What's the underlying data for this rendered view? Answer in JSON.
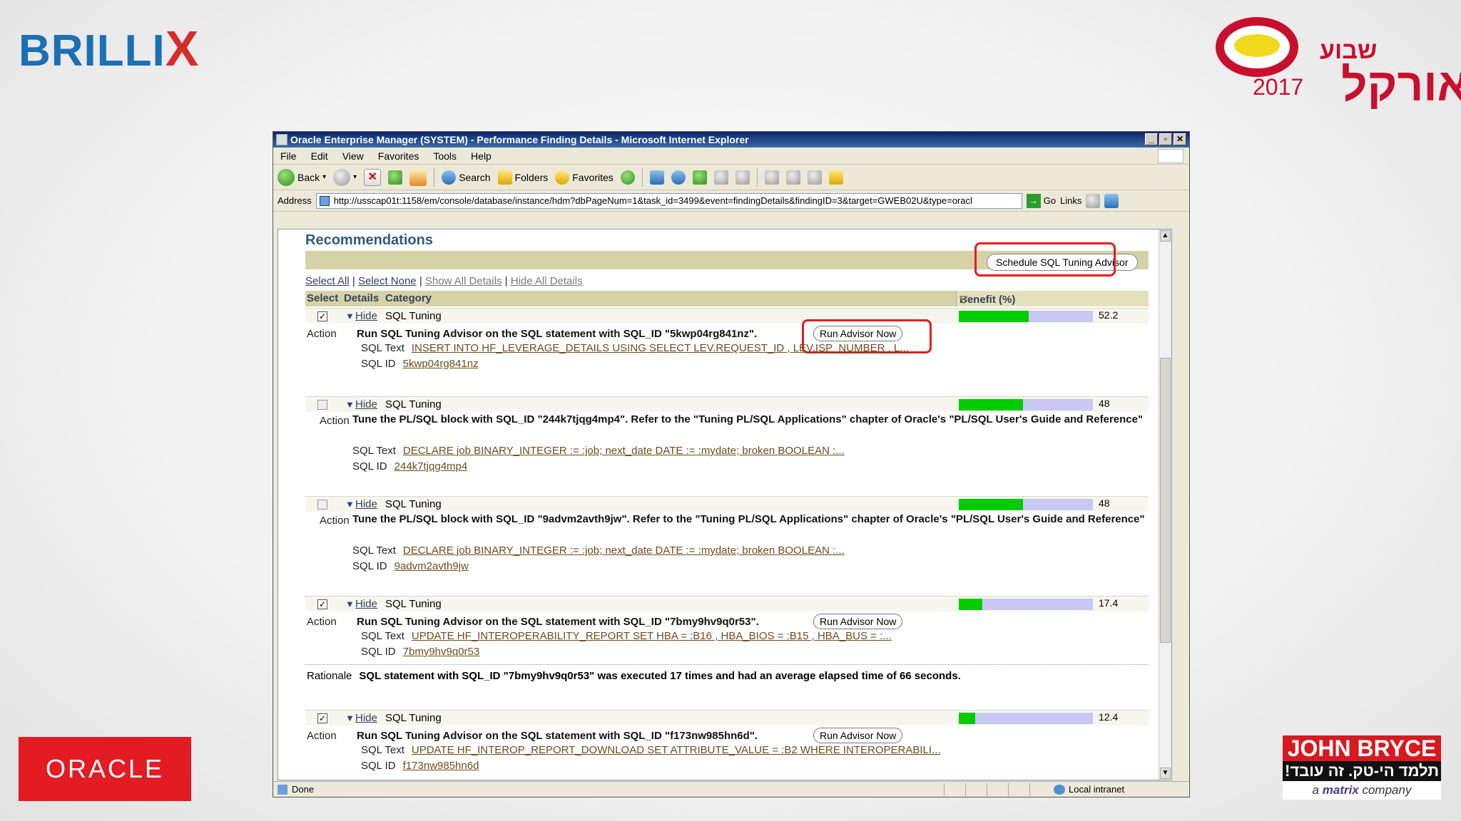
{
  "slide": {
    "brand_left": "BRILLI",
    "brand_left_x": "X",
    "event_year": "2017",
    "event_heb_small": "שבוע",
    "event_heb_big": "אורקל",
    "oracle": "ORACLE",
    "jb_name": "JOHN BRYCE",
    "jb_tagline": "תלמד הי-טק. זה עובד!",
    "jb_sub_a": "a ",
    "jb_sub_b": "matrix",
    "jb_sub_c": " company"
  },
  "window": {
    "title": "Oracle Enterprise Manager (SYSTEM) - Performance Finding Details - Microsoft Internet Explorer",
    "min": "_",
    "max": "▫",
    "close": "✕"
  },
  "menu": [
    "File",
    "Edit",
    "View",
    "Favorites",
    "Tools",
    "Help"
  ],
  "toolbar": {
    "back": "Back",
    "search": "Search",
    "folders": "Folders",
    "favorites": "Favorites"
  },
  "address": {
    "label": "Address",
    "url": "http://usscap01t:1158/em/console/database/instance/hdm?dbPageNum=1&task_id=3499&event=findingDetails&findingID=3&target=GWEB02U&type=oracl",
    "go": "Go",
    "links": "Links"
  },
  "page": {
    "title": "Recommendations",
    "schedule_button": "Schedule SQL Tuning Advisor",
    "select_all": "Select All",
    "select_none": "Select None",
    "show_all": "Show All Details",
    "hide_all": "Hide All Details",
    "col_select": "Select",
    "col_details": "Details",
    "col_category": "Category",
    "col_benefit": "Benefit (%)",
    "sort_icon": "sort-desc-icon",
    "action_label": "Action",
    "sqltext_label": "SQL Text",
    "sqlid_label": "SQL ID",
    "hide_label": "Hide",
    "rationale_label": "Rationale",
    "run_button": "Run Advisor Now"
  },
  "recommendations": [
    {
      "checked": true,
      "category": "SQL Tuning",
      "benefit": 52.2,
      "benefit_label": "52.2",
      "action": "Run SQL Tuning Advisor on the SQL statement with SQL_ID \"5kwp04rg841nz\".",
      "sql_text": "INSERT INTO HF_LEVERAGE_DETAILS USING SELECT LEV.REQUEST_ID , LEV.ISP_NUMBER , L...",
      "sql_id": "5kwp04rg841nz"
    },
    {
      "checked": false,
      "category": "SQL Tuning",
      "benefit": 48,
      "benefit_label": "48",
      "action": "Tune the PL/SQL block with SQL_ID \"244k7tjqg4mp4\". Refer to the \"Tuning PL/SQL Applications\" chapter of Oracle's \"PL/SQL User's Guide and Reference\"",
      "sql_text": "DECLARE job BINARY_INTEGER := :job; next_date DATE := :mydate; broken BOOLEAN :...",
      "sql_id": "244k7tjqg4mp4"
    },
    {
      "checked": false,
      "category": "SQL Tuning",
      "benefit": 48,
      "benefit_label": "48",
      "action": "Tune the PL/SQL block with SQL_ID \"9advm2avth9jw\". Refer to the \"Tuning PL/SQL Applications\" chapter of Oracle's \"PL/SQL User's Guide and Reference\"",
      "sql_text": "DECLARE job BINARY_INTEGER := :job; next_date DATE := :mydate; broken BOOLEAN :...",
      "sql_id": "9advm2avth9jw"
    },
    {
      "checked": true,
      "category": "SQL Tuning",
      "benefit": 17.4,
      "benefit_label": "17.4",
      "action": "Run SQL Tuning Advisor on the SQL statement with SQL_ID \"7bmy9hv9q0r53\".",
      "sql_text": "UPDATE HF_INTEROPERABILITY_REPORT SET HBA = :B16 , HBA_BIOS = :B15 , HBA_BUS = :...",
      "sql_id": "7bmy9hv9q0r53",
      "rationale": "SQL statement with SQL_ID \"7bmy9hv9q0r53\" was executed 17 times and had an average elapsed time of 66 seconds."
    },
    {
      "checked": true,
      "category": "SQL Tuning",
      "benefit": 12.4,
      "benefit_label": "12.4",
      "action": "Run SQL Tuning Advisor on the SQL statement with SQL_ID \"f173nw985hn6d\".",
      "sql_text": "UPDATE HF_INTEROP_REPORT_DOWNLOAD SET ATTRIBUTE_VALUE = :B2 WHERE INTEROPERABILI...",
      "sql_id": "f173nw985hn6d"
    }
  ],
  "status": {
    "text": "Done",
    "zone": "Local intranet"
  },
  "colors": {
    "bar_fill": "#00cc00",
    "bar_track": "#c8c8f4",
    "highlight": "#e41e1e",
    "header_band": "#d6d2a8"
  }
}
